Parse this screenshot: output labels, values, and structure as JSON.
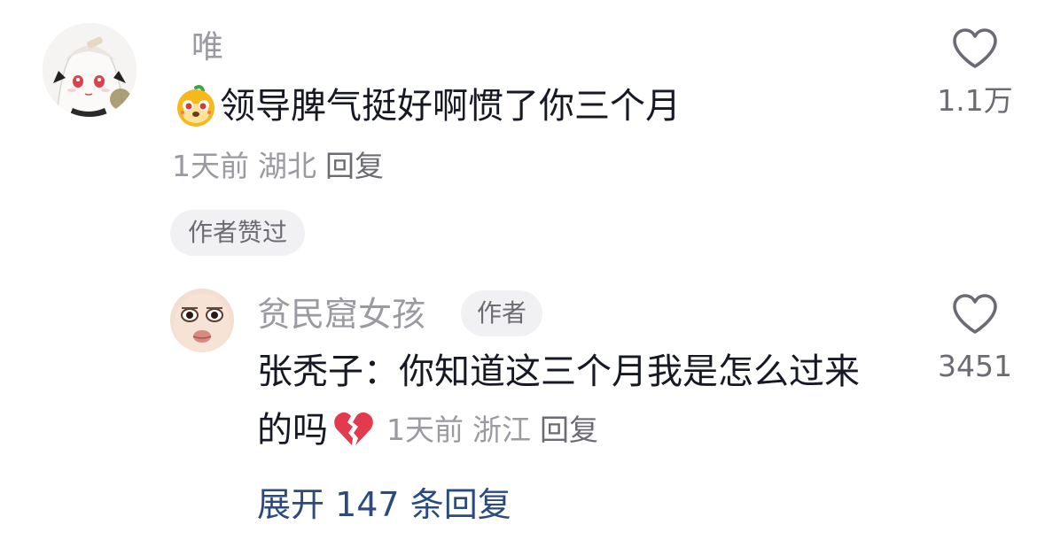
{
  "main_comment": {
    "username": "唯",
    "emoji": "dog-face-emoji",
    "text": "领导脾气挺好啊惯了你三个月",
    "time": "1天前",
    "location": "湖北",
    "reply_label": "回复",
    "author_liked_label": "作者赞过",
    "like_count": "1.1万"
  },
  "reply_comment": {
    "username": "贫民窟女孩",
    "author_tag": "作者",
    "text_line1": "张秃子：你知道这三个月我是怎么过来",
    "text_line2": "的吗",
    "emoji": "broken-heart-emoji",
    "time": "1天前",
    "location": "浙江",
    "reply_label": "回复",
    "like_count": "3451"
  },
  "expand_replies": "展开 147 条回复",
  "colors": {
    "primary_text": "#161823",
    "secondary_text": "#9a9aa1",
    "link": "#2b4a7e",
    "chip_bg": "#f1f1f3",
    "broken_heart": "#e23b4e"
  }
}
